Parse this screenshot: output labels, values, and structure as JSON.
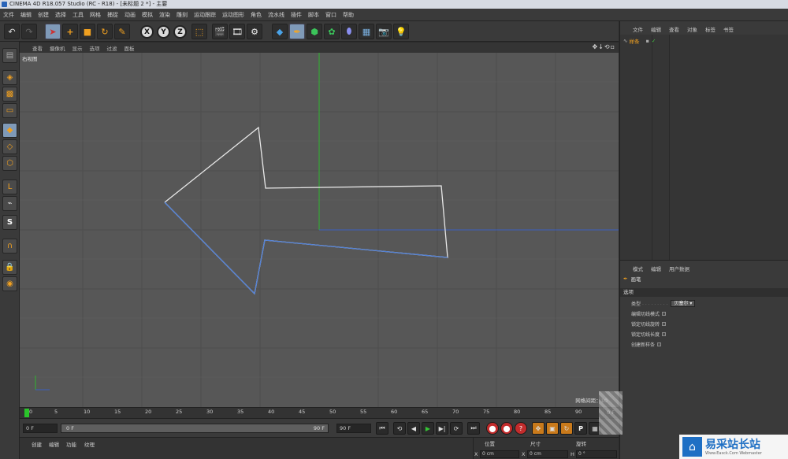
{
  "window": {
    "title": "CINEMA 4D R18.057 Studio (RC - R18) - [未标题 2 *] - 主要"
  },
  "menubar": [
    "文件",
    "编辑",
    "创建",
    "选择",
    "工具",
    "网格",
    "捕捉",
    "动画",
    "模拟",
    "渲染",
    "雕刻",
    "运动跟踪",
    "运动图形",
    "角色",
    "流水线",
    "插件",
    "脚本",
    "窗口",
    "帮助"
  ],
  "toolbar": {
    "axis_x": "X",
    "axis_y": "Y",
    "axis_z": "Z"
  },
  "viewport": {
    "menu": [
      "查看",
      "摄像机",
      "显示",
      "选项",
      "过滤",
      "面板"
    ],
    "view_name": "右视图",
    "grid_label": "网格间距：10"
  },
  "timeline": {
    "ticks": [
      "0",
      "5",
      "10",
      "15",
      "20",
      "25",
      "30",
      "35",
      "40",
      "45",
      "50",
      "55",
      "60",
      "65",
      "70",
      "75",
      "80",
      "85",
      "90"
    ],
    "current_frame": "0 F",
    "end_frame_display": "0 F"
  },
  "transport": {
    "start_field": "0 F",
    "range_start": "0 F",
    "range_end": "90 F",
    "end_field": "90 F"
  },
  "bottom_panel": {
    "menu": [
      "创建",
      "编辑",
      "功能",
      "纹理"
    ]
  },
  "coord_panel": {
    "headers": [
      "位置",
      "尺寸",
      "旋转"
    ],
    "x_label": "X",
    "x_pos": "0 cm",
    "x_label2": "X",
    "x_size": "0 cm",
    "h_label": "H",
    "h_rot": "0 °"
  },
  "object_manager": {
    "menu": [
      "文件",
      "编辑",
      "查看",
      "对象",
      "标签",
      "书签"
    ],
    "objects": [
      {
        "name": "样条"
      }
    ]
  },
  "attribute_manager": {
    "menu": [
      "模式",
      "编辑",
      "用户数据"
    ],
    "tool_name": "画笔",
    "section": "选项",
    "type_label": "类型",
    "type_value": "贝塞尔",
    "options": [
      "编辑切线模式",
      "锁定切线旋转",
      "锁定切线长度",
      "创建新样条"
    ]
  },
  "watermark": {
    "title": "易采站长站",
    "subtitle": "Www.Easck.Com Webmaster"
  },
  "colors": {
    "viewport_bg": "#575757",
    "spline_white": "#e8e8e8",
    "spline_blue": "#4f7fd6",
    "axis_green": "#2fb52f",
    "axis_blue": "#3b5fbf"
  }
}
